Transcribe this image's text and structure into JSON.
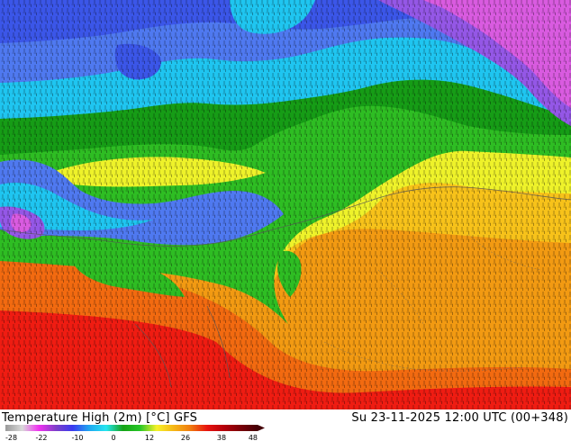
{
  "title": "Temperature High (2m) [°C] GFS",
  "datetime": "Su 23-11-2025 12:00 UTC (00+348)",
  "legend": {
    "ticks": [
      "-28",
      "-22",
      "-10",
      "0",
      "12",
      "26",
      "38",
      "48"
    ],
    "stops": [
      "#9a9a9a",
      "#d9d9d9",
      "#f030f0",
      "#7f3fc8",
      "#3a3af0",
      "#1fa8f0",
      "#25e6f0",
      "#15a315",
      "#26c626",
      "#f6f12a",
      "#f5b716",
      "#f07c0f",
      "#e8140f",
      "#b5000a",
      "#7a0008",
      "#440006"
    ]
  },
  "map": {
    "palette": {
      "magenta": "#d95be0",
      "violet": "#9457e6",
      "blue_dark": "#3b56e8",
      "blue": "#4f79f0",
      "cyan": "#1fc5f0",
      "green_dark": "#169c16",
      "green": "#2ebd23",
      "yellow": "#eef22a",
      "orange_light": "#f7c21a",
      "orange": "#f29a12",
      "red_orange": "#f26a10",
      "red": "#ef1c12"
    },
    "features": [
      "temperature-contour-lines",
      "coastline",
      "country-borders"
    ]
  }
}
